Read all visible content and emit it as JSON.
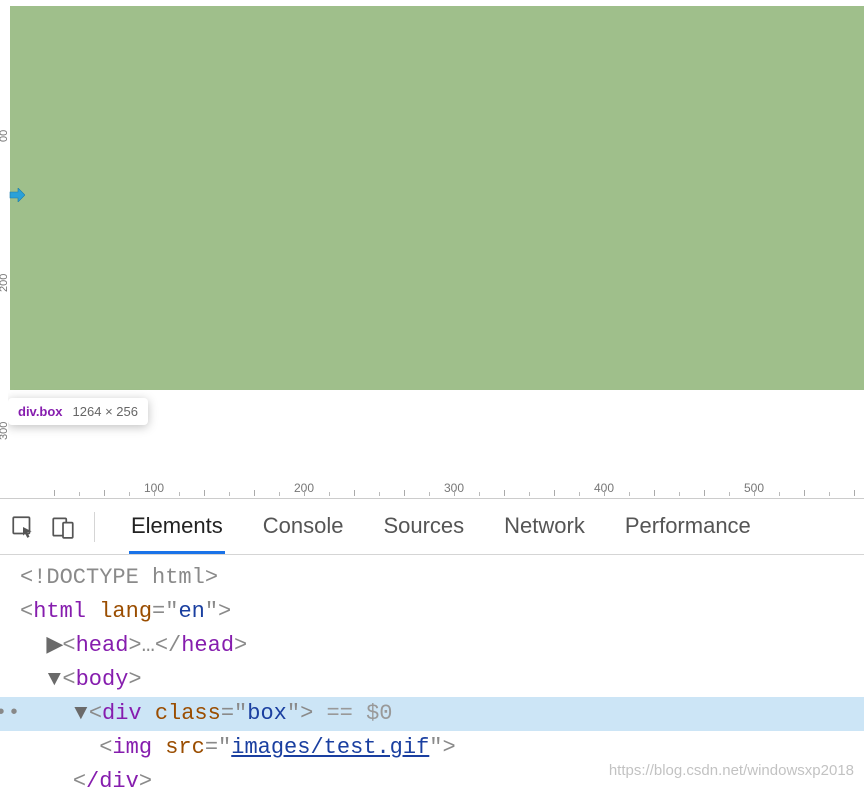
{
  "viewport": {
    "highlight_color": "#9fbf8b",
    "tooltip_selector": "div.box",
    "tooltip_dimensions": "1264 × 256",
    "v_ruler_marks": [
      "00",
      "200",
      "300"
    ],
    "h_ruler_marks": [
      "100",
      "200",
      "300",
      "400",
      "500"
    ]
  },
  "devtools": {
    "tabs": [
      "Elements",
      "Console",
      "Sources",
      "Network",
      "Performance"
    ],
    "active_tab": "Elements",
    "dom": {
      "doctype": "<!DOCTYPE html>",
      "html_tag": "html",
      "html_attr": "lang",
      "html_val": "en",
      "head_tag": "head",
      "head_ellipsis": "…",
      "body_tag": "body",
      "div_tag": "div",
      "div_attr": "class",
      "div_val": "box",
      "eq_sel": "== $0",
      "img_tag": "img",
      "img_attr": "src",
      "img_val": "images/test.gif",
      "div_close": "/div"
    }
  },
  "watermark": "https://blog.csdn.net/windowsxp2018"
}
